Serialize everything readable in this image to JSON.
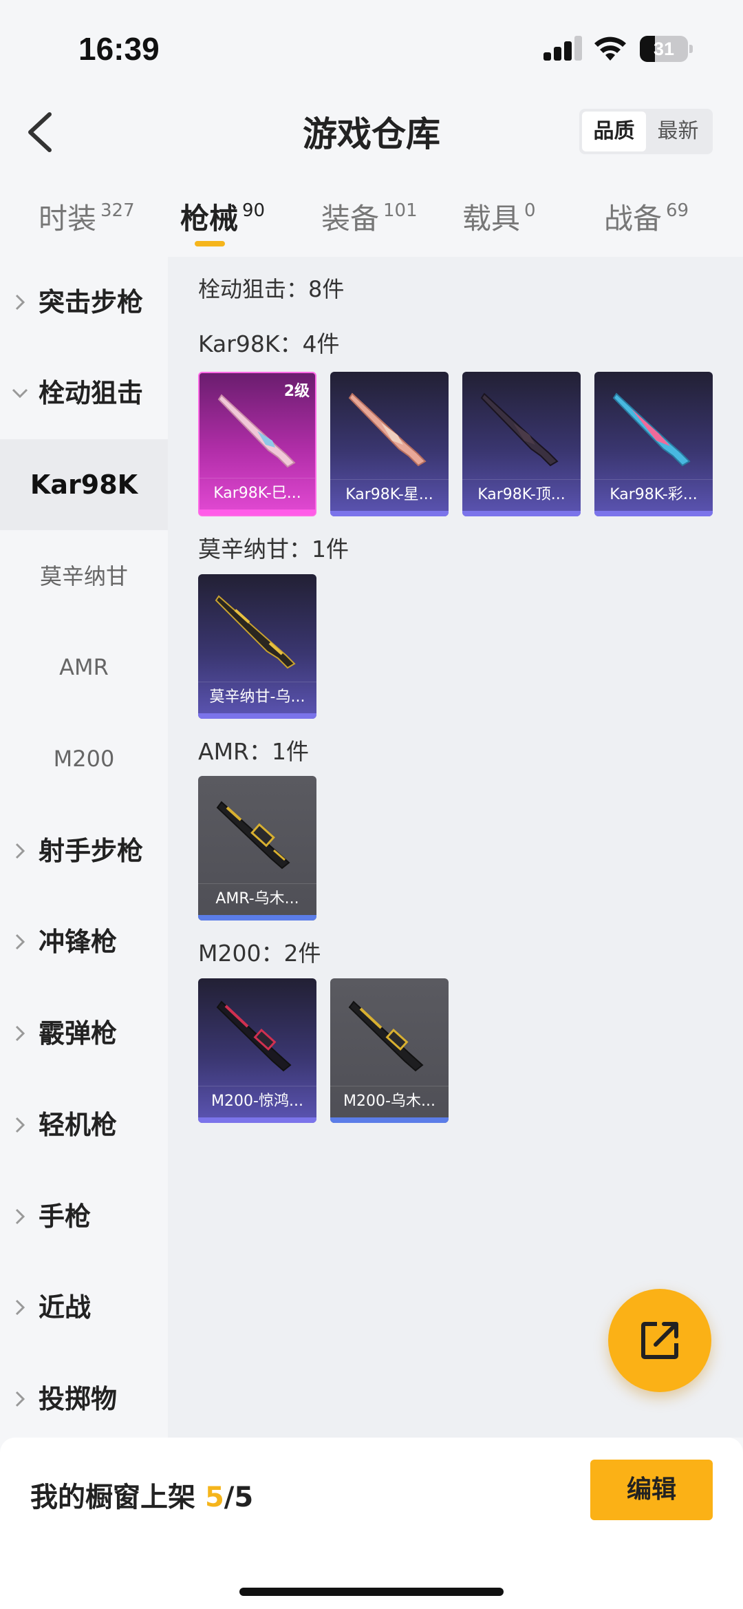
{
  "status_bar": {
    "time": "16:39",
    "battery": "31",
    "battery_level": 0.31
  },
  "header": {
    "title": "游戏仓库",
    "sort_options": [
      "品质",
      "最新"
    ],
    "active_sort": "品质"
  },
  "tabs": [
    {
      "label": "时装",
      "count": "327",
      "active": false
    },
    {
      "label": "枪械",
      "count": "90",
      "active": true
    },
    {
      "label": "装备",
      "count": "101",
      "active": false
    },
    {
      "label": "载具",
      "count": "0",
      "active": false
    },
    {
      "label": "战备",
      "count": "69",
      "active": false
    }
  ],
  "sidebar": {
    "categories": [
      {
        "label": "突击步枪",
        "expanded": false
      },
      {
        "label": "栓动狙击",
        "expanded": true
      },
      {
        "label": "射手步枪",
        "expanded": false
      },
      {
        "label": "冲锋枪",
        "expanded": false
      },
      {
        "label": "霰弹枪",
        "expanded": false
      },
      {
        "label": "轻机枪",
        "expanded": false
      },
      {
        "label": "手枪",
        "expanded": false
      },
      {
        "label": "近战",
        "expanded": false
      },
      {
        "label": "投掷物",
        "expanded": false
      }
    ],
    "sub_items": [
      {
        "label": "Kar98K",
        "active": true
      },
      {
        "label": "莫辛纳甘",
        "active": false
      },
      {
        "label": "AMR",
        "active": false
      },
      {
        "label": "M200",
        "active": false
      }
    ]
  },
  "content": {
    "category_summary": "栓动狙击：8件",
    "groups": [
      {
        "title": "Kar98K：4件",
        "items": [
          {
            "name": "Kar98K-巳...",
            "rarity": "pink",
            "level": "2级"
          },
          {
            "name": "Kar98K-星...",
            "rarity": "purple"
          },
          {
            "name": "Kar98K-顶...",
            "rarity": "purple"
          },
          {
            "name": "Kar98K-彩...",
            "rarity": "purple"
          }
        ]
      },
      {
        "title": "莫辛纳甘：1件",
        "items": [
          {
            "name": "莫辛纳甘-乌...",
            "rarity": "purple"
          }
        ]
      },
      {
        "title": "AMR：1件",
        "items": [
          {
            "name": "AMR-乌木...",
            "rarity": "gray"
          }
        ]
      },
      {
        "title": "M200：2件",
        "items": [
          {
            "name": "M200-惊鸿...",
            "rarity": "purple"
          },
          {
            "name": "M200-乌木...",
            "rarity": "gray"
          }
        ]
      }
    ]
  },
  "fab": {
    "icon": "share-export-icon"
  },
  "bottom_bar": {
    "shelf_label": "我的橱窗上架 ",
    "shelf_current": "5",
    "shelf_total": "/5",
    "edit_label": "编辑"
  },
  "colors": {
    "accent": "#fbb116",
    "purple_bar": "#7b74ea",
    "pink_bar": "#ff5ce8",
    "gray_bar": "#5b7de8"
  }
}
